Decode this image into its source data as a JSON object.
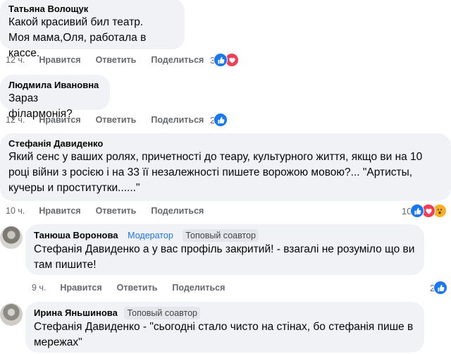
{
  "comments": [
    {
      "author": "Татьяна Волощук",
      "lines": [
        "Какой красивий бил театр.",
        "Моя мама,Оля, работала в кассе."
      ],
      "time": "12 ч.",
      "like_label": "Нравится",
      "reply_label": "Ответить",
      "share_label": "Поделиться",
      "reaction_count": "3",
      "reactions": [
        "like-icon",
        "love-icon"
      ]
    },
    {
      "author": "Людмила Ивановна",
      "lines": [
        "Зараз філармонія?"
      ],
      "time": "12 ч.",
      "like_label": "Нравится",
      "reply_label": "Ответить",
      "share_label": "Поделиться",
      "reaction_count": "2",
      "reactions": [
        "like-icon"
      ]
    },
    {
      "author": "Стефанія Давиденко",
      "lines": [
        "Який сенс у ваших ролях, причетності до теару, культурного життя, якщо ви на 10",
        "році війни з росією і на 33 її незалежності пишете ворожою мовою?... \"Артисты,",
        "кучеры и проститутки......\""
      ],
      "time": "10 ч.",
      "like_label": "Нравится",
      "reply_label": "Ответить",
      "share_label": "Поделиться",
      "reaction_count": "10",
      "reactions": [
        "like-icon",
        "love-icon",
        "wow-icon"
      ]
    }
  ],
  "replies": [
    {
      "author": "Танюша Воронова",
      "badge_moderator": "Модератор",
      "badge_top": "Топовый соавтор",
      "lines": [
        "Стефанія Давиденко а у вас профіль закритий! - взагалі не розуміло що ви",
        "там пишите!"
      ],
      "time": "9 ч.",
      "like_label": "Нравится",
      "reply_label": "Ответить",
      "share_label": "Поделиться",
      "reaction_count": "2",
      "reactions": [
        "like-icon"
      ]
    },
    {
      "author": "Ирина Яньшинова",
      "badge_top": "Топовый соавтор",
      "lines": [
        "Стефанія Давиденко - \"сьогодні стало чисто на стінах, бо стефанія пише в",
        "мережах\""
      ]
    }
  ],
  "colors": {
    "bubble": "#f0f2f5",
    "meta_text": "#65676b",
    "like": "#1877f2",
    "love": "#f33e58",
    "wow": "#f7b125",
    "moderator": "#1b74e4"
  }
}
